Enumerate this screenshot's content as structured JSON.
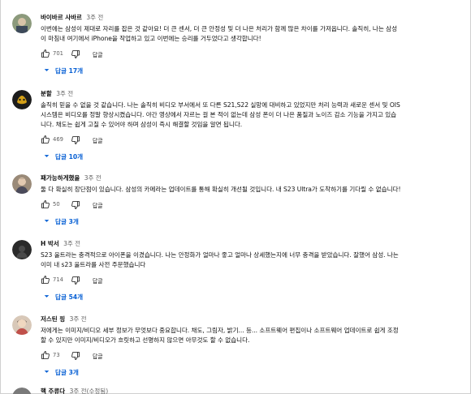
{
  "comments": [
    {
      "author": "바이바르 사바르",
      "time": "3주 전",
      "text_lines": [
        "이번에는 삼성이 제대로 자리를 잡은 것 같아요! 더 큰 센서, 더 큰 안정성 및 더 나은 처리가 함께 많은 차이를 가져옵니다. 솔직히, 나는 삼성",
        "이 마침내 여기에서 iPhone을 작업하고 있고 이번에는 승리를 거두었다고 생각합니다!"
      ],
      "likes": "701",
      "reply_label": "답글",
      "replies_label": "답글 17개",
      "avatar_color": "#7a8a6a"
    },
    {
      "author": "분할",
      "time": "3주 전",
      "text_lines": [
        "솔직히 믿을 수 없을 것 같습니다. 나는 솔직히 비디오 부서에서 또 다른 S21,S22 실망에 대비하고 있었지만 처리 능력과 새로운 센서 및 OIS",
        "시스템은 비디오를 정말 향상시켰습니다. 야간 영상에서 자르는 걸 본 적이 없는데 삼성 폰이 더 나은 품질과 노이즈 감소 기능을 가지고 있습",
        "니다. 채도는 쉽게 고칠 수 있어야 하며 삼성이 즉시 해결할 것임을 알면 됩니다."
      ],
      "likes": "469",
      "reply_label": "답글",
      "replies_label": "답글 10개",
      "avatar_color": "#1a1a1a"
    },
    {
      "author": "패가능하게했을",
      "time": "3주 전",
      "text_lines": [
        "둘 다 확실히 장단점이 있습니다. 삼성의 카메라는 업데이트를 통해 확실히 개선될 것입니다. 내 S23 Ultra가 도착하기를 기다릴 수 없습니다!"
      ],
      "likes": "50",
      "reply_label": "답글",
      "replies_label": "답글 3개",
      "avatar_color": "#8a7868"
    },
    {
      "author": "H 박서",
      "time": "3주 전",
      "text_lines": [
        "S23 울트라는 충격적으로 아이폰을 이겼습니다. 나는 안정화가 얼마나 좋고 얼마나 상세했는지에 너무 충격을 받았습니다. 잘했어 삼성. 나는",
        "이미 내 s23 울트라를 사전 주문했습니다"
      ],
      "likes": "714",
      "reply_label": "답글",
      "replies_label": "답글 54개",
      "avatar_color": "#2b2b2b"
    },
    {
      "author": "저스틴 핑",
      "time": "3주 전",
      "text_lines": [
        "저에게는 이미지/비디오 세부 정보가 무엇보다 중요합니다. 채도, 그림자, 밝기... 등... 소프트웨어 편집이나 소프트웨어 업데이트로 쉽게 조정",
        "할 수 있지만 이미지/비디오가 흐릿하고 선명하지 않으면 아무것도 할 수 없습니다."
      ],
      "likes": "73",
      "reply_label": "답글",
      "replies_label": "답글 3개",
      "avatar_color": "#c9b8a8"
    },
    {
      "author": "핵 주류다",
      "time": "3주 전(수정됨)",
      "text_lines": [],
      "likes": "",
      "reply_label": "",
      "replies_label": "",
      "avatar_color": "#888888"
    }
  ],
  "icons": {
    "like": "thumbs-up-icon",
    "dislike": "thumbs-down-icon",
    "expand": "chevron-down-icon"
  },
  "colors": {
    "link_blue": "#065fd4",
    "secondary_text": "#606060",
    "primary_text": "#0f0f0f"
  }
}
